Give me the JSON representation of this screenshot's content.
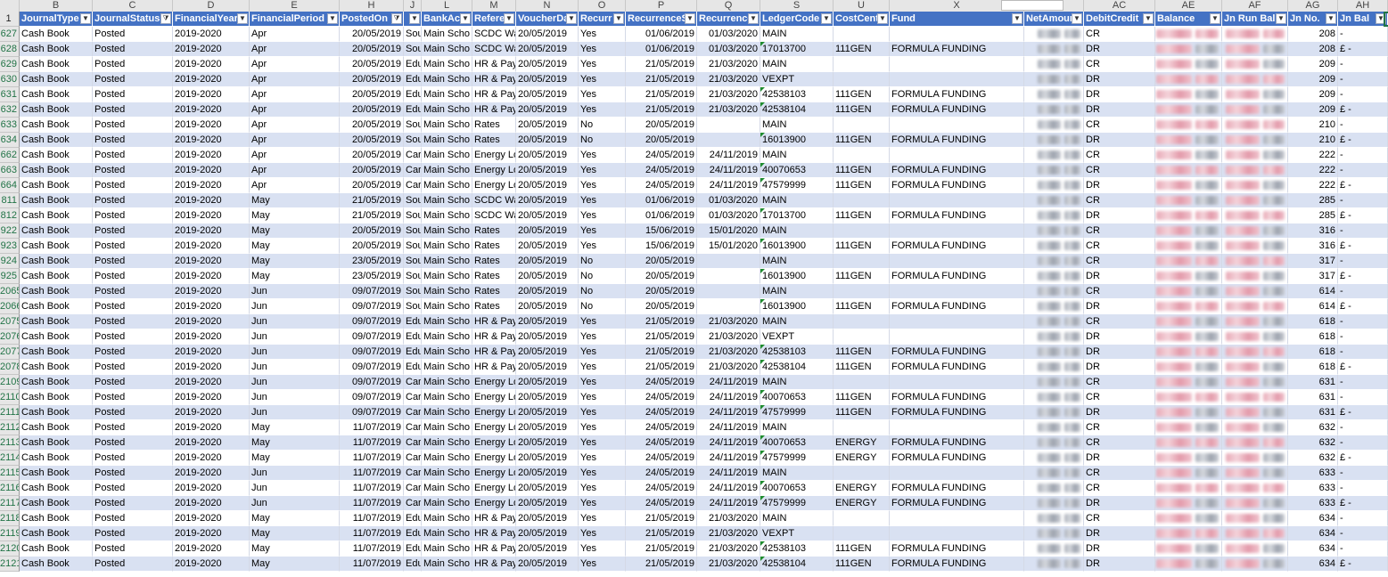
{
  "column_letters": [
    "B",
    "C",
    "D",
    "E",
    "H",
    "J",
    "L",
    "M",
    "N",
    "O",
    "P",
    "Q",
    "S",
    "U",
    "X",
    "AB",
    "AC",
    "AE",
    "AF",
    "AG",
    "AH"
  ],
  "header_row_number": "1",
  "headers": [
    "JournalType",
    "JournalStatus",
    "FinancialYear",
    "FinancialPeriod",
    "PostedOn",
    "",
    "BankAc",
    "Refere",
    "VoucherDa",
    "Recurr",
    "RecurrenceS",
    "Recurrence",
    "LedgerCode",
    "CostCent",
    "Fund",
    "NetAmount",
    "DebitCredit",
    "Balance",
    "Jn Run Bal",
    "Jn No.",
    "Jn Bal"
  ],
  "filter_active_columns": [
    "JournalStatus",
    "PostedOn"
  ],
  "colors": {
    "header_bg": "#4472c4",
    "band_bg": "#d9e1f2",
    "row_number_text": "#217346"
  },
  "rows": [
    {
      "n": "627",
      "f": [
        "Cash Book",
        "Posted",
        "2019-2020",
        "Apr",
        "20/05/2019",
        "Sou",
        "Main Scho",
        "SCDC Wa",
        "20/05/2019",
        "Yes",
        "01/06/2019",
        "01/03/2020",
        "MAIN",
        "",
        "",
        "",
        "CR",
        "",
        "",
        "208",
        "-"
      ]
    },
    {
      "n": "628",
      "f": [
        "Cash Book",
        "Posted",
        "2019-2020",
        "Apr",
        "20/05/2019",
        "Sou",
        "Main Scho",
        "SCDC Wa",
        "20/05/2019",
        "Yes",
        "01/06/2019",
        "01/03/2020",
        "17013700",
        "111GEN",
        "FORMULA FUNDING",
        "",
        "DR",
        "",
        "",
        "208",
        "£   -"
      ]
    },
    {
      "n": "629",
      "f": [
        "Cash Book",
        "Posted",
        "2019-2020",
        "Apr",
        "20/05/2019",
        "Edu",
        "Main Scho",
        "HR & Pay",
        "20/05/2019",
        "Yes",
        "21/05/2019",
        "21/03/2020",
        "MAIN",
        "",
        "",
        "",
        "CR",
        "",
        "",
        "209",
        "-"
      ]
    },
    {
      "n": "630",
      "f": [
        "Cash Book",
        "Posted",
        "2019-2020",
        "Apr",
        "20/05/2019",
        "Edu",
        "Main Scho",
        "HR & Pay",
        "20/05/2019",
        "Yes",
        "21/05/2019",
        "21/03/2020",
        "VEXPT",
        "",
        "",
        "",
        "DR",
        "",
        "",
        "209",
        "-"
      ]
    },
    {
      "n": "631",
      "f": [
        "Cash Book",
        "Posted",
        "2019-2020",
        "Apr",
        "20/05/2019",
        "Edu",
        "Main Scho",
        "HR & Pay",
        "20/05/2019",
        "Yes",
        "21/05/2019",
        "21/03/2020",
        "42538103",
        "111GEN",
        "FORMULA FUNDING",
        "",
        "DR",
        "",
        "",
        "209",
        "-"
      ]
    },
    {
      "n": "632",
      "f": [
        "Cash Book",
        "Posted",
        "2019-2020",
        "Apr",
        "20/05/2019",
        "Edu",
        "Main Scho",
        "HR & Pay",
        "20/05/2019",
        "Yes",
        "21/05/2019",
        "21/03/2020",
        "42538104",
        "111GEN",
        "FORMULA FUNDING",
        "",
        "DR",
        "",
        "",
        "209",
        "£   -"
      ]
    },
    {
      "n": "633",
      "f": [
        "Cash Book",
        "Posted",
        "2019-2020",
        "Apr",
        "20/05/2019",
        "Sou",
        "Main Scho",
        "Rates",
        "20/05/2019",
        "No",
        "20/05/2019",
        "",
        "MAIN",
        "",
        "",
        "",
        "CR",
        "",
        "",
        "210",
        "-"
      ]
    },
    {
      "n": "634",
      "f": [
        "Cash Book",
        "Posted",
        "2019-2020",
        "Apr",
        "20/05/2019",
        "Sou",
        "Main Scho",
        "Rates",
        "20/05/2019",
        "No",
        "20/05/2019",
        "",
        "16013900",
        "111GEN",
        "FORMULA FUNDING",
        "",
        "DR",
        "",
        "",
        "210",
        "£   -"
      ]
    },
    {
      "n": "662",
      "f": [
        "Cash Book",
        "Posted",
        "2019-2020",
        "Apr",
        "20/05/2019",
        "Car",
        "Main Scho",
        "Energy Lo",
        "20/05/2019",
        "Yes",
        "24/05/2019",
        "24/11/2019",
        "MAIN",
        "",
        "",
        "",
        "CR",
        "",
        "",
        "222",
        "-"
      ]
    },
    {
      "n": "663",
      "f": [
        "Cash Book",
        "Posted",
        "2019-2020",
        "Apr",
        "20/05/2019",
        "Car",
        "Main Scho",
        "Energy Lo",
        "20/05/2019",
        "Yes",
        "24/05/2019",
        "24/11/2019",
        "40070653",
        "111GEN",
        "FORMULA FUNDING",
        "",
        "CR",
        "",
        "",
        "222",
        "-"
      ]
    },
    {
      "n": "664",
      "f": [
        "Cash Book",
        "Posted",
        "2019-2020",
        "Apr",
        "20/05/2019",
        "Car",
        "Main Scho",
        "Energy Lo",
        "20/05/2019",
        "Yes",
        "24/05/2019",
        "24/11/2019",
        "47579999",
        "111GEN",
        "FORMULA FUNDING",
        "",
        "DR",
        "",
        "",
        "222",
        "£   -"
      ]
    },
    {
      "n": "811",
      "f": [
        "Cash Book",
        "Posted",
        "2019-2020",
        "May",
        "21/05/2019",
        "Sou",
        "Main Scho",
        "SCDC Wa",
        "20/05/2019",
        "Yes",
        "01/06/2019",
        "01/03/2020",
        "MAIN",
        "",
        "",
        "",
        "CR",
        "",
        "",
        "285",
        "-"
      ]
    },
    {
      "n": "812",
      "f": [
        "Cash Book",
        "Posted",
        "2019-2020",
        "May",
        "21/05/2019",
        "Sou",
        "Main Scho",
        "SCDC Wa",
        "20/05/2019",
        "Yes",
        "01/06/2019",
        "01/03/2020",
        "17013700",
        "111GEN",
        "FORMULA FUNDING",
        "",
        "DR",
        "",
        "",
        "285",
        "£   -"
      ]
    },
    {
      "n": "922",
      "f": [
        "Cash Book",
        "Posted",
        "2019-2020",
        "May",
        "20/05/2019",
        "Sou",
        "Main Scho",
        "Rates",
        "20/05/2019",
        "Yes",
        "15/06/2019",
        "15/01/2020",
        "MAIN",
        "",
        "",
        "",
        "CR",
        "",
        "",
        "316",
        "-"
      ]
    },
    {
      "n": "923",
      "f": [
        "Cash Book",
        "Posted",
        "2019-2020",
        "May",
        "20/05/2019",
        "Sou",
        "Main Scho",
        "Rates",
        "20/05/2019",
        "Yes",
        "15/06/2019",
        "15/01/2020",
        "16013900",
        "111GEN",
        "FORMULA FUNDING",
        "",
        "CR",
        "",
        "",
        "316",
        "£   -"
      ]
    },
    {
      "n": "924",
      "f": [
        "Cash Book",
        "Posted",
        "2019-2020",
        "May",
        "23/05/2019",
        "Sou",
        "Main Scho",
        "Rates",
        "20/05/2019",
        "No",
        "20/05/2019",
        "",
        "MAIN",
        "",
        "",
        "",
        "CR",
        "",
        "",
        "317",
        "-"
      ]
    },
    {
      "n": "925",
      "f": [
        "Cash Book",
        "Posted",
        "2019-2020",
        "May",
        "23/05/2019",
        "Sou",
        "Main Scho",
        "Rates",
        "20/05/2019",
        "No",
        "20/05/2019",
        "",
        "16013900",
        "111GEN",
        "FORMULA FUNDING",
        "",
        "DR",
        "",
        "",
        "317",
        "£   -"
      ]
    },
    {
      "n": "2065",
      "f": [
        "Cash Book",
        "Posted",
        "2019-2020",
        "Jun",
        "09/07/2019",
        "Sou",
        "Main Scho",
        "Rates",
        "20/05/2019",
        "No",
        "20/05/2019",
        "",
        "MAIN",
        "",
        "",
        "",
        "CR",
        "",
        "",
        "614",
        "-"
      ]
    },
    {
      "n": "2066",
      "f": [
        "Cash Book",
        "Posted",
        "2019-2020",
        "Jun",
        "09/07/2019",
        "Sou",
        "Main Scho",
        "Rates",
        "20/05/2019",
        "No",
        "20/05/2019",
        "",
        "16013900",
        "111GEN",
        "FORMULA FUNDING",
        "",
        "DR",
        "",
        "",
        "614",
        "£   -"
      ]
    },
    {
      "n": "2075",
      "f": [
        "Cash Book",
        "Posted",
        "2019-2020",
        "Jun",
        "09/07/2019",
        "Edu",
        "Main Scho",
        "HR & Pay",
        "20/05/2019",
        "Yes",
        "21/05/2019",
        "21/03/2020",
        "MAIN",
        "",
        "",
        "",
        "CR",
        "",
        "",
        "618",
        "-"
      ]
    },
    {
      "n": "2076",
      "f": [
        "Cash Book",
        "Posted",
        "2019-2020",
        "Jun",
        "09/07/2019",
        "Edu",
        "Main Scho",
        "HR & Pay",
        "20/05/2019",
        "Yes",
        "21/05/2019",
        "21/03/2020",
        "VEXPT",
        "",
        "",
        "",
        "DR",
        "",
        "",
        "618",
        "-"
      ]
    },
    {
      "n": "2077",
      "f": [
        "Cash Book",
        "Posted",
        "2019-2020",
        "Jun",
        "09/07/2019",
        "Edu",
        "Main Scho",
        "HR & Pay",
        "20/05/2019",
        "Yes",
        "21/05/2019",
        "21/03/2020",
        "42538103",
        "111GEN",
        "FORMULA FUNDING",
        "",
        "DR",
        "",
        "",
        "618",
        "-"
      ]
    },
    {
      "n": "2078",
      "f": [
        "Cash Book",
        "Posted",
        "2019-2020",
        "Jun",
        "09/07/2019",
        "Edu",
        "Main Scho",
        "HR & Pay",
        "20/05/2019",
        "Yes",
        "21/05/2019",
        "21/03/2020",
        "42538104",
        "111GEN",
        "FORMULA FUNDING",
        "",
        "DR",
        "",
        "",
        "618",
        "£   -"
      ]
    },
    {
      "n": "2109",
      "f": [
        "Cash Book",
        "Posted",
        "2019-2020",
        "Jun",
        "09/07/2019",
        "Car",
        "Main Scho",
        "Energy Lo",
        "20/05/2019",
        "Yes",
        "24/05/2019",
        "24/11/2019",
        "MAIN",
        "",
        "",
        "",
        "CR",
        "",
        "",
        "631",
        "-"
      ]
    },
    {
      "n": "2110",
      "f": [
        "Cash Book",
        "Posted",
        "2019-2020",
        "Jun",
        "09/07/2019",
        "Car",
        "Main Scho",
        "Energy Lo",
        "20/05/2019",
        "Yes",
        "24/05/2019",
        "24/11/2019",
        "40070653",
        "111GEN",
        "FORMULA FUNDING",
        "",
        "CR",
        "",
        "",
        "631",
        "-"
      ]
    },
    {
      "n": "2111",
      "f": [
        "Cash Book",
        "Posted",
        "2019-2020",
        "Jun",
        "09/07/2019",
        "Car",
        "Main Scho",
        "Energy Lo",
        "20/05/2019",
        "Yes",
        "24/05/2019",
        "24/11/2019",
        "47579999",
        "111GEN",
        "FORMULA FUNDING",
        "",
        "DR",
        "",
        "",
        "631",
        "£   -"
      ]
    },
    {
      "n": "2112",
      "f": [
        "Cash Book",
        "Posted",
        "2019-2020",
        "May",
        "11/07/2019",
        "Car",
        "Main Scho",
        "Energy Lo",
        "20/05/2019",
        "Yes",
        "24/05/2019",
        "24/11/2019",
        "MAIN",
        "",
        "",
        "",
        "CR",
        "",
        "",
        "632",
        "-"
      ]
    },
    {
      "n": "2113",
      "f": [
        "Cash Book",
        "Posted",
        "2019-2020",
        "May",
        "11/07/2019",
        "Car",
        "Main Scho",
        "Energy Lo",
        "20/05/2019",
        "Yes",
        "24/05/2019",
        "24/11/2019",
        "40070653",
        "ENERGY",
        "FORMULA FUNDING",
        "",
        "CR",
        "",
        "",
        "632",
        "-"
      ]
    },
    {
      "n": "2114",
      "f": [
        "Cash Book",
        "Posted",
        "2019-2020",
        "May",
        "11/07/2019",
        "Car",
        "Main Scho",
        "Energy Lo",
        "20/05/2019",
        "Yes",
        "24/05/2019",
        "24/11/2019",
        "47579999",
        "ENERGY",
        "FORMULA FUNDING",
        "",
        "DR",
        "",
        "",
        "632",
        "£   -"
      ]
    },
    {
      "n": "2115",
      "f": [
        "Cash Book",
        "Posted",
        "2019-2020",
        "Jun",
        "11/07/2019",
        "Car",
        "Main Scho",
        "Energy Lo",
        "20/05/2019",
        "Yes",
        "24/05/2019",
        "24/11/2019",
        "MAIN",
        "",
        "",
        "",
        "CR",
        "",
        "",
        "633",
        "-"
      ]
    },
    {
      "n": "2116",
      "f": [
        "Cash Book",
        "Posted",
        "2019-2020",
        "Jun",
        "11/07/2019",
        "Car",
        "Main Scho",
        "Energy Lo",
        "20/05/2019",
        "Yes",
        "24/05/2019",
        "24/11/2019",
        "40070653",
        "ENERGY",
        "FORMULA FUNDING",
        "",
        "CR",
        "",
        "",
        "633",
        "-"
      ]
    },
    {
      "n": "2117",
      "f": [
        "Cash Book",
        "Posted",
        "2019-2020",
        "Jun",
        "11/07/2019",
        "Car",
        "Main Scho",
        "Energy Lo",
        "20/05/2019",
        "Yes",
        "24/05/2019",
        "24/11/2019",
        "47579999",
        "ENERGY",
        "FORMULA FUNDING",
        "",
        "DR",
        "",
        "",
        "633",
        "£   -"
      ]
    },
    {
      "n": "2118",
      "f": [
        "Cash Book",
        "Posted",
        "2019-2020",
        "May",
        "11/07/2019",
        "Edu",
        "Main Scho",
        "HR & Pay",
        "20/05/2019",
        "Yes",
        "21/05/2019",
        "21/03/2020",
        "MAIN",
        "",
        "",
        "",
        "CR",
        "",
        "",
        "634",
        "-"
      ]
    },
    {
      "n": "2119",
      "f": [
        "Cash Book",
        "Posted",
        "2019-2020",
        "May",
        "11/07/2019",
        "Edu",
        "Main Scho",
        "HR & Pay",
        "20/05/2019",
        "Yes",
        "21/05/2019",
        "21/03/2020",
        "VEXPT",
        "",
        "",
        "",
        "DR",
        "",
        "",
        "634",
        "-"
      ]
    },
    {
      "n": "2120",
      "f": [
        "Cash Book",
        "Posted",
        "2019-2020",
        "May",
        "11/07/2019",
        "Edu",
        "Main Scho",
        "HR & Pay",
        "20/05/2019",
        "Yes",
        "21/05/2019",
        "21/03/2020",
        "42538103",
        "111GEN",
        "FORMULA FUNDING",
        "",
        "DR",
        "",
        "",
        "634",
        "-"
      ]
    },
    {
      "n": "2121",
      "f": [
        "Cash Book",
        "Posted",
        "2019-2020",
        "May",
        "11/07/2019",
        "Edu",
        "Main Scho",
        "HR & Pay",
        "20/05/2019",
        "Yes",
        "21/05/2019",
        "21/03/2020",
        "42538104",
        "111GEN",
        "FORMULA FUNDING",
        "",
        "DR",
        "",
        "",
        "634",
        "£   -"
      ]
    }
  ]
}
